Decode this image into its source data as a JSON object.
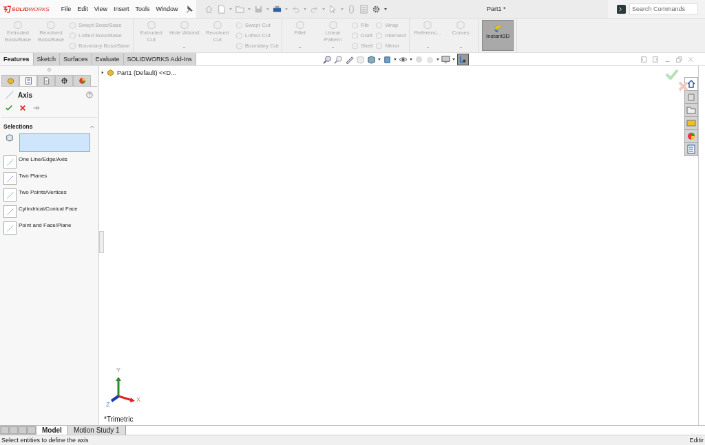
{
  "titlebar": {
    "logo": "**SOLID**WORKS",
    "menu": [
      "File",
      "Edit",
      "View",
      "Insert",
      "Tools",
      "Window"
    ],
    "title": "Part1 *",
    "search": {
      "placeholder": "Search Commands"
    }
  },
  "ribbon": {
    "groups": [
      {
        "items": [
          {
            "kind": "large",
            "label": "Extruded Boss/Base",
            "disabled": true,
            "menu": false
          },
          {
            "kind": "large",
            "label": "Revolved Boss/Base",
            "disabled": true,
            "menu": false
          },
          {
            "kind": "stack",
            "items": [
              {
                "label": "Swept Boss/Base",
                "disabled": true
              },
              {
                "label": "Lofted Boss/Base",
                "disabled": true
              },
              {
                "label": "Boundary Boss/Base",
                "disabled": true
              }
            ]
          }
        ]
      },
      {
        "items": [
          {
            "kind": "large",
            "label": "Extruded Cut",
            "disabled": true,
            "menu": false
          },
          {
            "kind": "large",
            "label": "Hole Wizard",
            "disabled": true,
            "menu": true
          },
          {
            "kind": "large",
            "label": "Revolved Cut",
            "disabled": true,
            "menu": false
          },
          {
            "kind": "stack",
            "items": [
              {
                "label": "Swept Cut",
                "disabled": true
              },
              {
                "label": "Lofted Cut",
                "disabled": true
              },
              {
                "label": "Boundary Cut",
                "disabled": true
              }
            ]
          }
        ]
      },
      {
        "items": [
          {
            "kind": "large",
            "label": "Fillet",
            "disabled": true,
            "menu": true
          },
          {
            "kind": "large",
            "label": "Linear Pattern",
            "disabled": true,
            "menu": true
          },
          {
            "kind": "stack",
            "items": [
              {
                "label": "Rib",
                "disabled": true
              },
              {
                "label": "Draft",
                "disabled": true
              },
              {
                "label": "Shell",
                "disabled": true
              }
            ]
          },
          {
            "kind": "stack",
            "items": [
              {
                "label": "Wrap",
                "disabled": true
              },
              {
                "label": "Intersect",
                "disabled": true
              },
              {
                "label": "Mirror",
                "disabled": true
              }
            ]
          }
        ]
      },
      {
        "items": [
          {
            "kind": "large",
            "label": "Referenc...",
            "disabled": true,
            "menu": true
          },
          {
            "kind": "large",
            "label": "Curves",
            "disabled": true,
            "menu": true
          }
        ]
      },
      {
        "items": [
          {
            "kind": "toggle",
            "label": "Instant3D",
            "on": true
          }
        ]
      }
    ]
  },
  "command_tabs": [
    {
      "label": "Features",
      "selected": true
    },
    {
      "label": "Sketch",
      "selected": false
    },
    {
      "label": "Surfaces",
      "selected": false
    },
    {
      "label": "Evaluate",
      "selected": false
    },
    {
      "label": "SOLIDWORKS Add-Ins",
      "selected": false
    }
  ],
  "panel_tabs": [
    {
      "kind": "tree",
      "selected": false
    },
    {
      "kind": "property",
      "selected": true
    },
    {
      "kind": "config",
      "selected": false
    },
    {
      "kind": "target",
      "selected": false
    },
    {
      "kind": "display",
      "selected": false
    }
  ],
  "property_manager": {
    "title": "Axis",
    "section": {
      "title": "Selections",
      "expanded": true
    },
    "options": [
      "One Line/Edge/Axis",
      "Two Planes",
      "Two Points/Vertices",
      "Cylindrical/Conical Face",
      "Point and Face/Plane"
    ]
  },
  "feature_tree": {
    "root": "Part1 (Default) <<D...",
    "expanded": false
  },
  "triad": {
    "x": "X",
    "y": "Y",
    "z": "Z"
  },
  "view_name": "*Trimetric",
  "bottom_tabs": [
    {
      "label": "Model",
      "selected": true
    },
    {
      "label": "Motion Study 1",
      "selected": false
    }
  ],
  "status_bar": {
    "message": "Select entities to define the axis",
    "mode": "Editir"
  }
}
